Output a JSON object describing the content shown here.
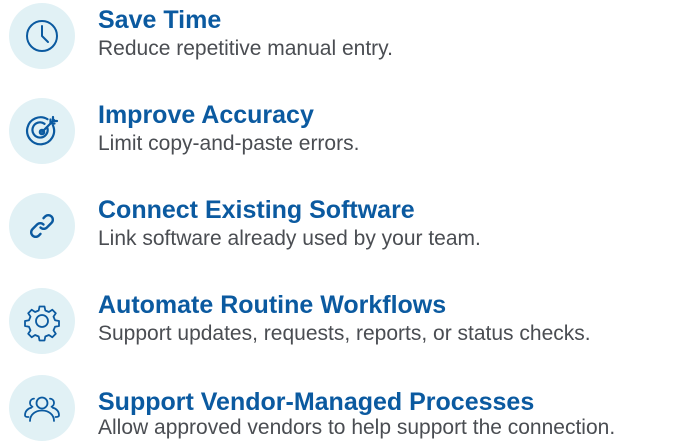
{
  "benefits": [
    {
      "icon": "clock-icon",
      "title": "Save Time",
      "description": "Reduce repetitive manual entry."
    },
    {
      "icon": "target-icon",
      "title": "Improve Accuracy",
      "description": "Limit copy-and-paste errors."
    },
    {
      "icon": "link-icon",
      "title": "Connect Existing Software",
      "description": "Link software already used by your team."
    },
    {
      "icon": "gear-icon",
      "title": "Automate Routine Workflows",
      "description": "Support updates, requests, reports, or status checks."
    },
    {
      "icon": "users-icon",
      "title": "Support Vendor-Managed Processes",
      "description": "Allow approved vendors to help support the connection."
    }
  ],
  "colors": {
    "title": "#0b5aa0",
    "description": "#4a4d52",
    "icon_stroke": "#0b5aa0",
    "icon_background": "#e1f1f5"
  }
}
